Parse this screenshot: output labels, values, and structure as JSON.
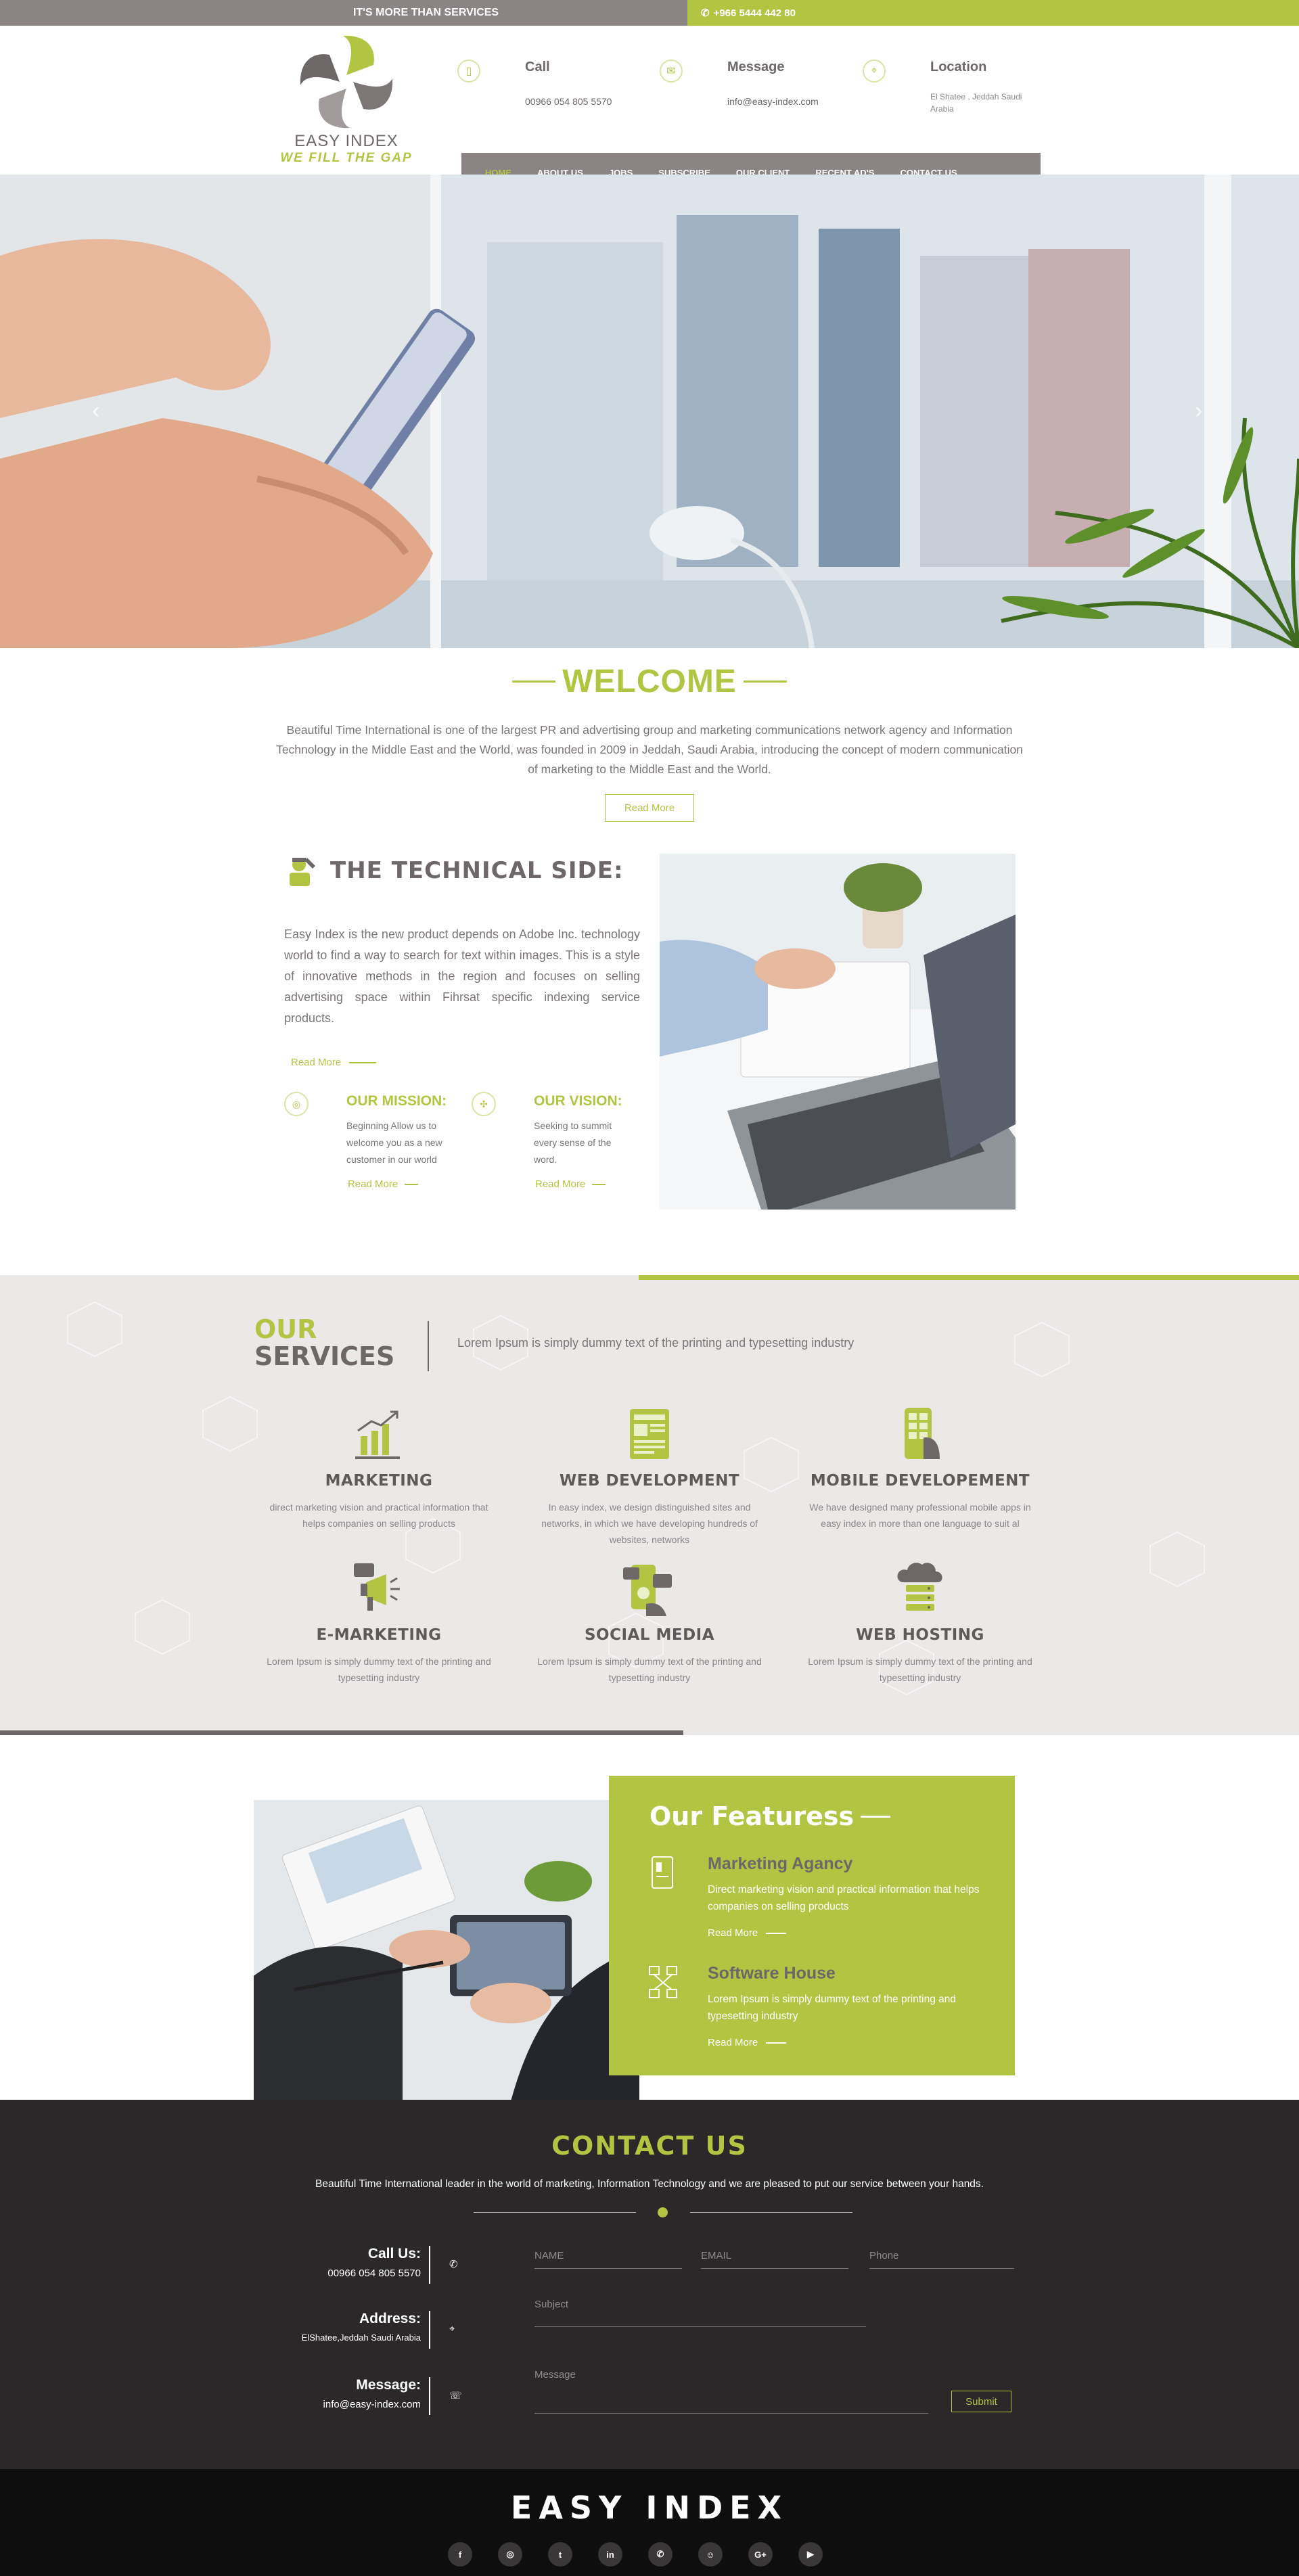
{
  "topbar": {
    "tagline": "IT'S MORE THAN SERVICES",
    "phone": "+966 5444 442 80"
  },
  "logo": {
    "brand": "EASY INDEX",
    "tagline": "WE FILL THE GAP"
  },
  "header": {
    "call": {
      "title": "Call",
      "value": "00966 054 805 5570"
    },
    "message": {
      "title": "Message",
      "value": "info@easy-index.com"
    },
    "location": {
      "title": "Location",
      "value": "El Shatee , Jeddah Saudi Arabia"
    }
  },
  "nav": {
    "items": [
      "HOME",
      "ABOUT US",
      "JOBS",
      "SUBSCRIBE",
      "OUR CLIENT",
      "RECENT AD'S",
      "CONTACT US"
    ]
  },
  "hero": {
    "prev": "‹",
    "next": "›"
  },
  "welcome": {
    "title": "WELCOME",
    "text": "Beautiful Time International is one of the largest PR and advertising group and marketing communications network agency and Information Technology in the Middle East and the World, was founded in 2009 in Jeddah, Saudi Arabia, introducing the concept of modern communication of marketing to the Middle East and the World.",
    "button": "Read More"
  },
  "technical": {
    "title": "THE TECHNICAL SIDE:",
    "text": "Easy Index is the new product depends on Adobe Inc. technology world to find a way to search for text within images. This is a style of innovative methods in the region and focuses on selling advertising space within Fihrsat specific indexing service products.",
    "more": "Read More",
    "mission": {
      "title": "OUR MISSION:",
      "text": "Beginning Allow us to welcome you as a new customer in our world",
      "more": "Read More"
    },
    "vision": {
      "title": "OUR VISION:",
      "text": "Seeking to summit every sense of the word.",
      "more": "Read More"
    }
  },
  "services": {
    "heading_our": "OUR",
    "heading_services": "SERVICES",
    "subtitle": "Lorem Ipsum is simply dummy text of the printing and typesetting industry",
    "items": [
      {
        "title": "MARKETING",
        "text": "direct marketing vision and practical information that helps companies on selling products",
        "icon": "marketing-chart-icon"
      },
      {
        "title": "WEB DEVELOPMENT",
        "text": "In easy index, we design distinguished sites and networks, in which we have developing hundreds of websites, networks",
        "icon": "web-development-icon"
      },
      {
        "title": "MOBILE DEVELOPEMENT",
        "text": "We have designed many professional mobile apps in easy index in more than one language to suit al",
        "icon": "mobile-development-icon"
      },
      {
        "title": "E-MARKETING",
        "text": "Lorem Ipsum is simply dummy text of the printing and typesetting industry",
        "icon": "megaphone-icon"
      },
      {
        "title": "SOCIAL MEDIA",
        "text": "Lorem Ipsum is simply dummy text of the printing and typesetting industry",
        "icon": "social-media-icon"
      },
      {
        "title": "WEB HOSTING",
        "text": "Lorem Ipsum is simply dummy text of the printing and typesetting industry",
        "icon": "cloud-server-icon"
      }
    ]
  },
  "features": {
    "title": "Our Featuress",
    "items": [
      {
        "title": "Marketing Agancy",
        "text": "Direct marketing vision and practical information that helps companies on selling products",
        "more": "Read More"
      },
      {
        "title": "Software House",
        "text": "Lorem Ipsum is simply dummy text of the printing and typesetting industry",
        "more": "Read More"
      }
    ]
  },
  "contact": {
    "title": "CONTACT US",
    "subtitle": "Beautiful Time International leader in the world of marketing, Information Technology and we are pleased to put our service between your hands.",
    "call_label": "Call Us:",
    "call_value": "00966 054 805 5570",
    "address_label": "Address:",
    "address_value": "ElShatee,Jeddah Saudi Arabia",
    "message_label": "Message:",
    "message_value": "info@easy-index.com",
    "form": {
      "name": "NAME",
      "email": "EMAIL",
      "phone": "Phone",
      "subject": "Subject",
      "message": "Message",
      "submit": "Submit"
    }
  },
  "footer": {
    "brand": "EASY INDEX",
    "socials": [
      "f",
      "◎",
      "t",
      "in",
      "✆",
      "☺",
      "G+",
      "▶"
    ]
  },
  "colors": {
    "accent": "#b2c543",
    "gray": "#8b8485",
    "dark": "#2b2829"
  }
}
